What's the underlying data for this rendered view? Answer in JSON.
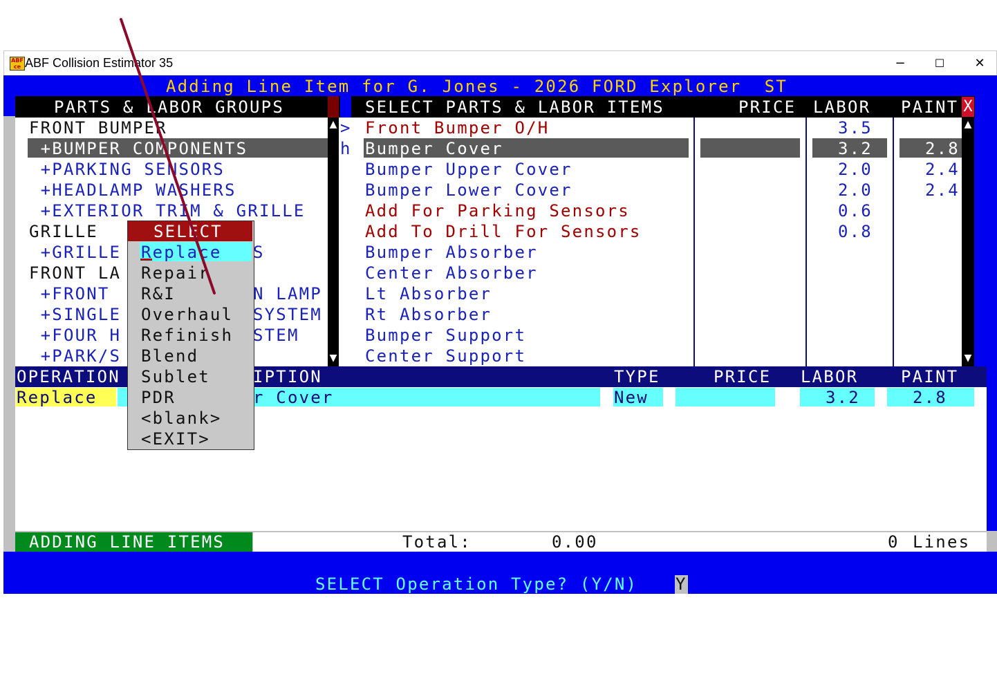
{
  "window": {
    "title": "ABF Collision Estimator 35",
    "minimize_glyph": "−",
    "maximize_glyph": "☐",
    "close_glyph": "✕",
    "icon": "abf-app-icon"
  },
  "header": {
    "text": "Adding Line Item for G. Jones - 2026 FORD Explorer  ST"
  },
  "groups_panel": {
    "title": "PARTS & LABOR GROUPS",
    "items": [
      {
        "label": "FRONT BUMPER",
        "kind": "header"
      },
      {
        "label": " +BUMPER COMPONENTS",
        "kind": "selected"
      },
      {
        "label": " +PARKING SENSORS",
        "kind": "sub"
      },
      {
        "label": " +HEADLAMP WASHERS",
        "kind": "sub"
      },
      {
        "label": " +EXTERIOR TRIM & GRILLE",
        "kind": "sub"
      },
      {
        "label": "GRILLE",
        "kind": "header"
      },
      {
        "label": " +GRILLE",
        "kind": "sub",
        "tail": "S"
      },
      {
        "label": "FRONT LA",
        "kind": "header"
      },
      {
        "label": " +FRONT",
        "kind": "sub",
        "tail": "N LAMP"
      },
      {
        "label": " +SINGLE",
        "kind": "sub",
        "tail": "SYSTEM"
      },
      {
        "label": " +FOUR H",
        "kind": "sub",
        "tail": "STEM"
      },
      {
        "label": " +PARK/S",
        "kind": "sub"
      }
    ],
    "arrow_marker": ">",
    "partial_char": "h"
  },
  "items_panel": {
    "title": "SELECT PARTS & LABOR ITEMS",
    "col_price": "PRICE",
    "col_labor": "LABOR",
    "col_paint": "PAINT",
    "close_glyph": "X",
    "rows": [
      {
        "desc": "Front Bumper O/H",
        "price": "",
        "labor": "3.5",
        "paint": "",
        "color": "red"
      },
      {
        "desc": "Bumper Cover",
        "price": "",
        "labor": "3.2",
        "paint": "2.8",
        "color": "selected"
      },
      {
        "desc": "Bumper Upper Cover",
        "price": "",
        "labor": "2.0",
        "paint": "2.4",
        "color": "blue"
      },
      {
        "desc": "Bumper Lower Cover",
        "price": "",
        "labor": "2.0",
        "paint": "2.4",
        "color": "blue"
      },
      {
        "desc": "Add For Parking Sensors",
        "price": "",
        "labor": "0.6",
        "paint": "",
        "color": "red"
      },
      {
        "desc": "Add To Drill For Sensors",
        "price": "",
        "labor": "0.8",
        "paint": "",
        "color": "red"
      },
      {
        "desc": "Bumper Absorber",
        "price": "",
        "labor": "",
        "paint": "",
        "color": "blue"
      },
      {
        "desc": "Center Absorber",
        "price": "",
        "labor": "",
        "paint": "",
        "color": "blue"
      },
      {
        "desc": "Lt Absorber",
        "price": "",
        "labor": "",
        "paint": "",
        "color": "blue"
      },
      {
        "desc": "Rt Absorber",
        "price": "",
        "labor": "",
        "paint": "",
        "color": "blue"
      },
      {
        "desc": "Bumper Support",
        "price": "",
        "labor": "",
        "paint": "",
        "color": "blue"
      },
      {
        "desc": "Center Support",
        "price": "",
        "labor": "",
        "paint": "",
        "color": "blue"
      }
    ]
  },
  "line_table": {
    "col_operation": "OPERATION",
    "col_description_tail": "IPTION",
    "col_type": "TYPE",
    "col_price": "PRICE",
    "col_labor": "LABOR",
    "col_paint": "PAINT",
    "row": {
      "operation": "Replace",
      "description_tail": "r Cover",
      "type": "New",
      "price": "",
      "labor": "3.2",
      "paint": "2.8"
    }
  },
  "select_menu": {
    "title": "SELECT",
    "options": [
      "Replace",
      "Repair",
      "R&I",
      "Overhaul",
      "Refinish",
      "Blend",
      "Sublet",
      "PDR",
      "<blank>",
      "<EXIT>"
    ],
    "highlighted_index": 0
  },
  "status_bar": {
    "mode": "ADDING LINE ITEMS",
    "total_label": "Total:",
    "total_value": "0.00",
    "lines_count": "0",
    "lines_label": "Lines"
  },
  "prompt": {
    "text": "SELECT Operation Type? (Y/N)",
    "answer": "Y"
  },
  "colors": {
    "console_blue": "#0000f0",
    "navy": "#0c0c7c",
    "panel_grey": "#c0c0c0",
    "highlight_cyan": "#66ffff",
    "operation_yellow": "#ffff55",
    "status_green": "#008a1e",
    "item_red": "#a00000",
    "item_blue": "#1a22b8",
    "header_gold": "#ffd400",
    "menu_title_red": "#a01010"
  }
}
